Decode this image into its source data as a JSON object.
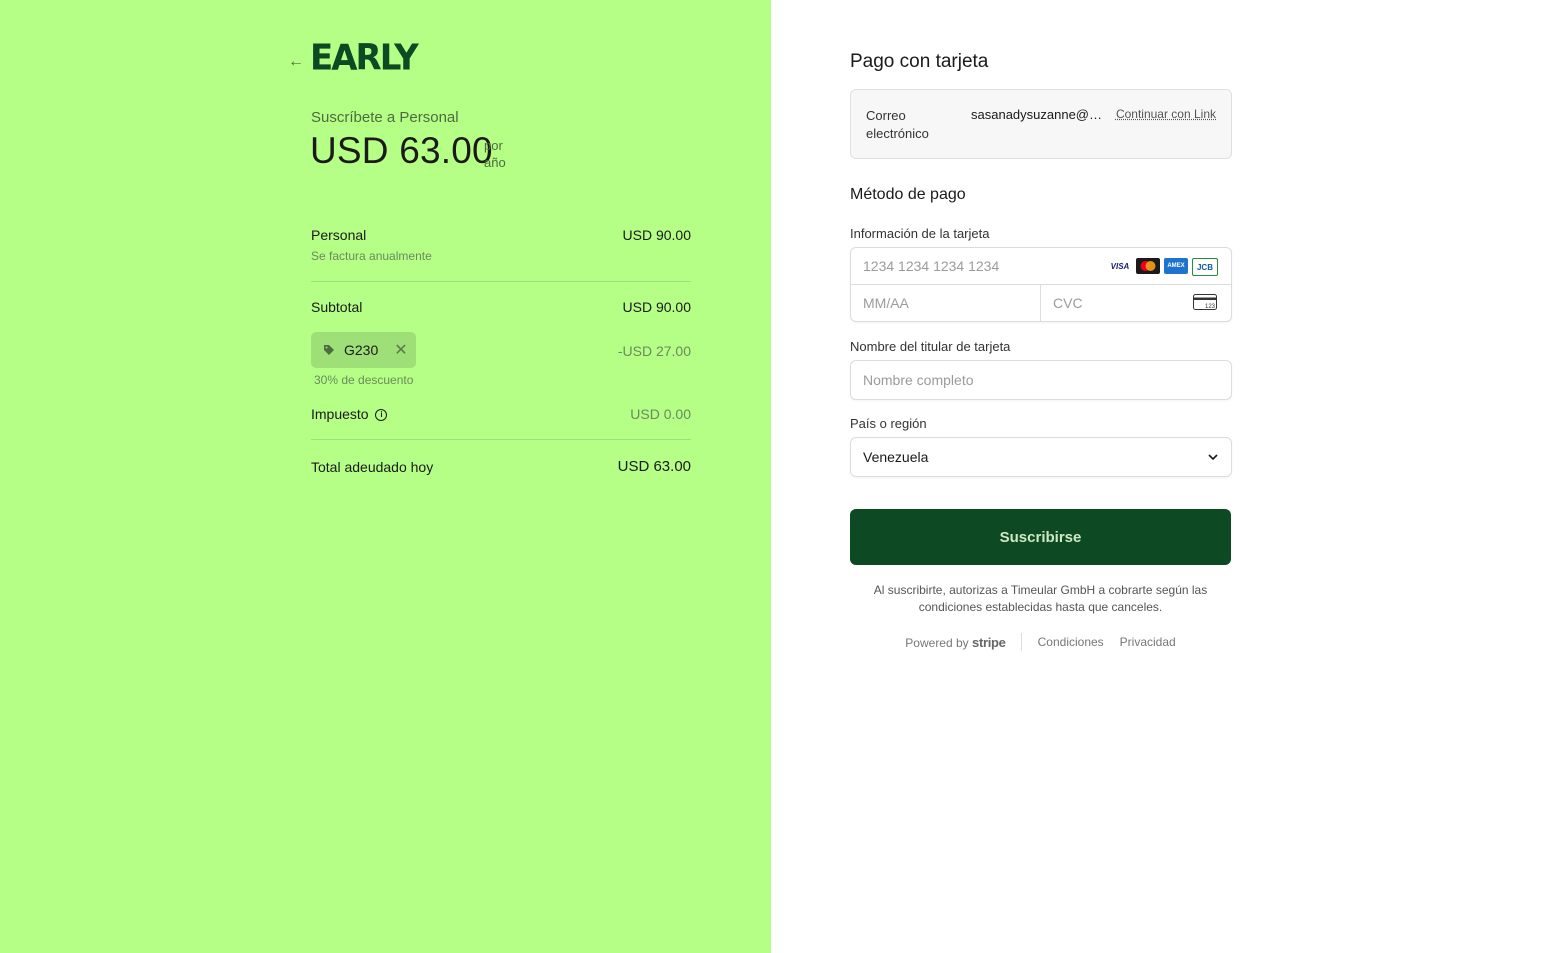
{
  "brand": {
    "logo_text": "EARLY",
    "back_arrow": "←"
  },
  "summary": {
    "subscribe_title": "Suscríbete a Personal",
    "price": "USD 63.00",
    "per_line1": "por",
    "per_line2": "año",
    "plan_name": "Personal",
    "plan_price": "USD 90.00",
    "billing_note": "Se factura anualmente",
    "subtotal_label": "Subtotal",
    "subtotal_value": "USD 90.00",
    "promo_code": "G230",
    "promo_discount": "-USD 27.00",
    "promo_note": "30% de descuento",
    "tax_label": "Impuesto",
    "tax_value": "USD 0.00",
    "total_label": "Total adeudado hoy",
    "total_value": "USD 63.00"
  },
  "payment": {
    "title": "Pago con tarjeta",
    "email_label": "Correo electrónico",
    "email_value": "sasanadysuzanne@gmail.com",
    "link_label": "Continuar con Link",
    "method_title": "Método de pago",
    "card_info_label": "Información de la tarjeta",
    "card_number_placeholder": "1234 1234 1234 1234",
    "expiry_placeholder": "MM/AA",
    "cvc_placeholder": "CVC",
    "cvc_icon_text": "123",
    "brands": [
      {
        "name": "visa-icon",
        "label": "VISA",
        "bg": "#ffffff",
        "fg": "#1a1f71"
      },
      {
        "name": "mastercard-icon",
        "label": "",
        "bg": "#1a1a1a",
        "fg": "#ffffff"
      },
      {
        "name": "amex-icon",
        "label": "AMEX",
        "bg": "#1f72cd",
        "fg": "#ffffff"
      },
      {
        "name": "jcb-icon",
        "label": "JCB",
        "bg": "#ffffff",
        "fg": "#0b5aa7"
      }
    ],
    "cardholder_label": "Nombre del titular de tarjeta",
    "cardholder_placeholder": "Nombre completo",
    "country_label": "País o región",
    "country_value": "Venezuela",
    "submit_label": "Suscribirse",
    "legal_text": "Al suscribirte, autorizas a Timeular GmbH a cobrarte según las condiciones establecidas hasta que canceles.",
    "powered_by": "Powered by",
    "stripe": "stripe",
    "terms": "Condiciones",
    "privacy": "Privacidad"
  },
  "colors": {
    "left_bg": "#b6ff86",
    "button_bg": "#0d4a23",
    "logo": "#0b4a22"
  }
}
